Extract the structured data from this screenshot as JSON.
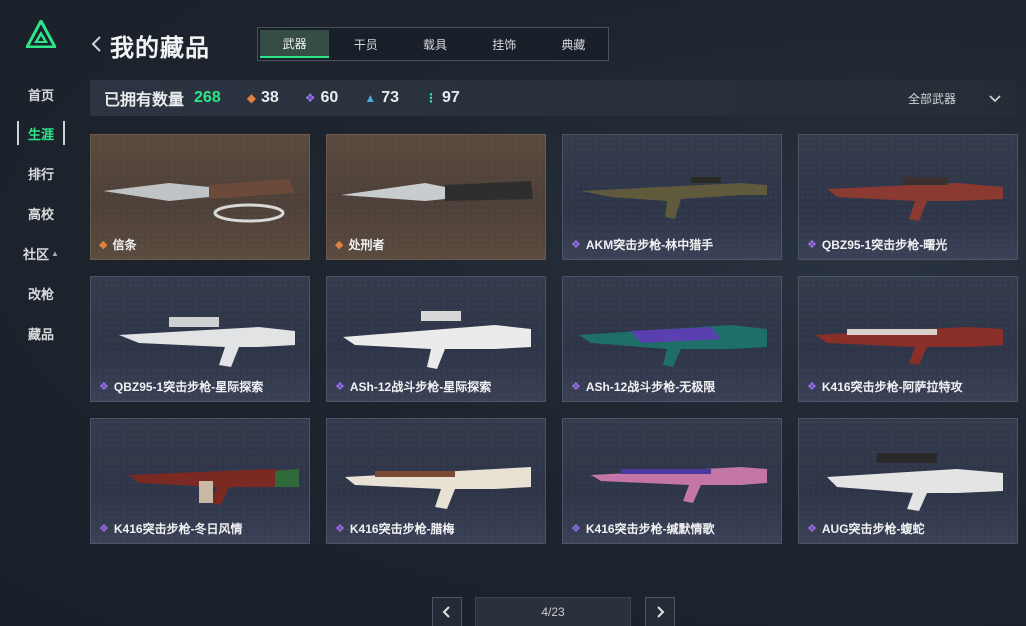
{
  "header": {
    "title": "我的藏品"
  },
  "nav": {
    "items": [
      {
        "label": "首页"
      },
      {
        "label": "生涯"
      },
      {
        "label": "排行"
      },
      {
        "label": "高校"
      },
      {
        "label": "社区"
      },
      {
        "label": "改枪"
      },
      {
        "label": "藏品"
      }
    ],
    "active": "生涯"
  },
  "tabs": [
    {
      "label": "武器"
    },
    {
      "label": "干员"
    },
    {
      "label": "载具"
    },
    {
      "label": "挂饰"
    },
    {
      "label": "典藏"
    }
  ],
  "stats": {
    "owned_label": "已拥有数量",
    "owned_count": "268",
    "rarity_counts": [
      {
        "count": "38",
        "gem": "gold",
        "color": "#e2813e"
      },
      {
        "count": "60",
        "gem": "purple",
        "color": "#9b6ff0"
      },
      {
        "count": "73",
        "gem": "blue",
        "color": "#4aa7e0"
      },
      {
        "count": "97",
        "gem": "green",
        "color": "#2ee5b0"
      }
    ],
    "filter_label": "全部武器"
  },
  "items": [
    {
      "name": "信条",
      "rarity": "gold"
    },
    {
      "name": "处刑者",
      "rarity": "gold"
    },
    {
      "name": "AKM突击步枪-林中猎手",
      "rarity": "purple"
    },
    {
      "name": "QBZ95-1突击步枪-曙光",
      "rarity": "purple"
    },
    {
      "name": "QBZ95-1突击步枪-星际探索",
      "rarity": "purple"
    },
    {
      "name": "ASh-12战斗步枪-星际探索",
      "rarity": "purple"
    },
    {
      "name": "ASh-12战斗步枪-无极限",
      "rarity": "purple"
    },
    {
      "name": "K416突击步枪-阿萨拉特攻",
      "rarity": "purple"
    },
    {
      "name": "K416突击步枪-冬日风情",
      "rarity": "purple"
    },
    {
      "name": "K416突击步枪-腊梅",
      "rarity": "purple"
    },
    {
      "name": "K416突击步枪-缄默情歌",
      "rarity": "purple"
    },
    {
      "name": "AUG突击步枪-蝮蛇",
      "rarity": "purple"
    }
  ],
  "pagination": {
    "indicator": "4/23"
  },
  "colors": {
    "accent": "#2ee58a",
    "gold": "#e2813e",
    "purple": "#9b6ff0"
  }
}
